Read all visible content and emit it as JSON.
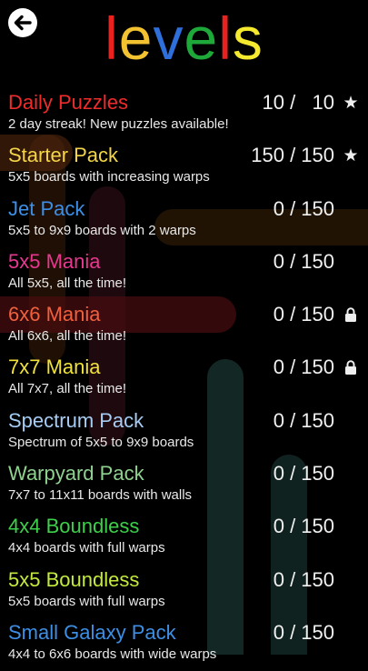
{
  "header": {
    "back_icon": "back-arrow-icon",
    "title_letters": [
      {
        "char": "l",
        "color": "#e8231f"
      },
      {
        "char": "e",
        "color": "#f2c230"
      },
      {
        "char": "v",
        "color": "#2e6fdb"
      },
      {
        "char": "e",
        "color": "#1fa83a"
      },
      {
        "char": "l",
        "color": "#e8231f"
      },
      {
        "char": "s",
        "color": "#f5e92f"
      }
    ]
  },
  "packs": [
    {
      "name": "Daily Puzzles",
      "color": "#ef2b2b",
      "desc": "2 day streak!  New puzzles available!",
      "count": "10 /   10",
      "icon": "star-icon"
    },
    {
      "name": "Starter Pack",
      "color": "#f4d547",
      "desc": "5x5 boards with increasing warps",
      "count": "150 / 150",
      "icon": "star-icon"
    },
    {
      "name": "Jet Pack",
      "color": "#3d8fe6",
      "desc": "5x5 to 9x9 boards with 2 warps",
      "count": "0 / 150",
      "icon": ""
    },
    {
      "name": "5x5 Mania",
      "color": "#e8378f",
      "desc": "All 5x5, all the time!",
      "count": "0 / 150",
      "icon": ""
    },
    {
      "name": "6x6 Mania",
      "color": "#f0603d",
      "desc": "All 6x6, all the time!",
      "count": "0 / 150",
      "icon": "lock-icon"
    },
    {
      "name": "7x7 Mania",
      "color": "#f1e23a",
      "desc": "All 7x7, all the time!",
      "count": "0 / 150",
      "icon": "lock-icon"
    },
    {
      "name": "Spectrum Pack",
      "color": "#a7cdf4",
      "desc": "Spectrum of 5x5 to 9x9 boards",
      "count": "0 / 150",
      "icon": ""
    },
    {
      "name": "Warpyard Pack",
      "color": "#8fd18f",
      "desc": "7x7 to 11x11 boards with walls",
      "count": "0 / 150",
      "icon": ""
    },
    {
      "name": "4x4 Boundless",
      "color": "#3dd04a",
      "desc": "4x4 boards with full warps",
      "count": "0 / 150",
      "icon": ""
    },
    {
      "name": "5x5 Boundless",
      "color": "#c3ea3c",
      "desc": "5x5 boards with full warps",
      "count": "0 / 150",
      "icon": ""
    },
    {
      "name": "Small Galaxy Pack",
      "color": "#3d8fe6",
      "desc": "4x4 to 6x6 boards with wide warps",
      "count": "0 / 150",
      "icon": ""
    }
  ]
}
